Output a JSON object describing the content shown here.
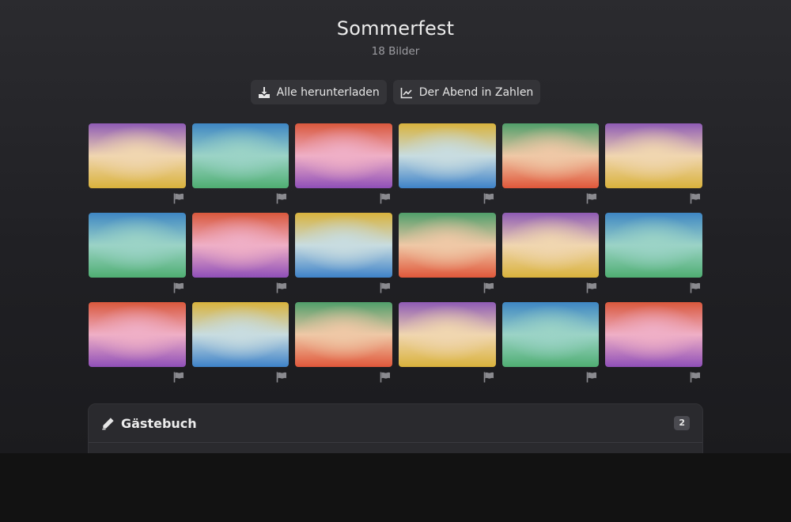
{
  "gallery": {
    "title": "Sommerfest",
    "subtitle": "18 Bilder"
  },
  "actions": {
    "download_all": {
      "label": "Alle herunterladen",
      "icon": "download-icon"
    },
    "stats": {
      "label": "Der Abend in Zahlen",
      "icon": "chart-line-icon"
    }
  },
  "palette": {
    "purple-yellow": [
      "#8e5bb5",
      "#f0d6b0",
      "#d9b23c"
    ],
    "blue-green": [
      "#3e86c4",
      "#9bd3c6",
      "#4fae72"
    ],
    "red-purple": [
      "#d9583c",
      "#efafc6",
      "#8f4fb8"
    ],
    "yellow-blue": [
      "#d9b23c",
      "#c8dce0",
      "#3e82c8"
    ],
    "green-red": [
      "#4f9e6a",
      "#efc8a6",
      "#e0573a"
    ]
  },
  "photos": [
    "purple-yellow",
    "blue-green",
    "red-purple",
    "yellow-blue",
    "green-red",
    "purple-yellow",
    "blue-green",
    "red-purple",
    "yellow-blue",
    "green-red",
    "purple-yellow",
    "blue-green",
    "red-purple",
    "yellow-blue",
    "green-red",
    "purple-yellow",
    "blue-green",
    "red-purple"
  ],
  "flag_icon": "flag-icon",
  "guestbook": {
    "title": "Gästebuch",
    "count": "2",
    "icon": "pencil-icon"
  }
}
